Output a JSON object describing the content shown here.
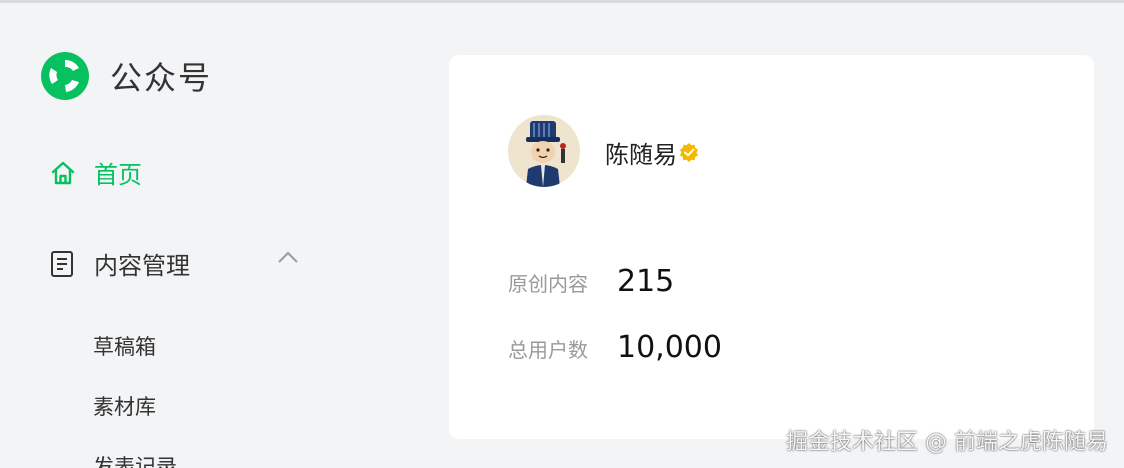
{
  "brand": {
    "name": "公众号",
    "icon": "wechat-mp-logo-icon",
    "color": "#07c160"
  },
  "sidebar": {
    "home": {
      "label": "首页",
      "icon": "home-icon",
      "active": true
    },
    "content_management": {
      "label": "内容管理",
      "icon": "document-icon",
      "expanded": true,
      "children": [
        {
          "label": "草稿箱"
        },
        {
          "label": "素材库"
        },
        {
          "label": "发表记录"
        }
      ]
    }
  },
  "profile": {
    "name": "陈随易",
    "avatar_icon": "avatar-cartoon-icon",
    "verified_icon": "verified-badge-icon",
    "verified_color": "#f5b800",
    "stats": [
      {
        "label": "原创内容",
        "value": "215"
      },
      {
        "label": "总用户数",
        "value": "10,000"
      }
    ]
  },
  "watermark": "掘金技术社区 @ 前端之虎陈随易"
}
